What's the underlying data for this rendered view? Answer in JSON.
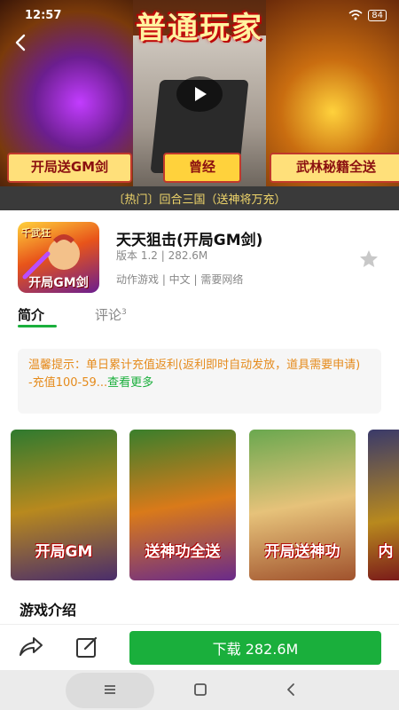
{
  "status_bar": {
    "time": "12:57",
    "battery": "84"
  },
  "banner": {
    "title_art": "普通玩家",
    "tag_left": "开局送GM剑",
    "tag_mid": "曾经",
    "tag_right": "武林秘籍全送"
  },
  "news_strip": "〔热门〕回合三国（送神将万充）",
  "app": {
    "icon_top": "千武狂",
    "icon_label": "开局GM剑",
    "title": "天天狙击(开局GM剑)",
    "meta": "版本 1.2 | 282.6M",
    "tags": "动作游戏 | 中文 | 需要网络"
  },
  "tabs": {
    "intro": "简介",
    "reviews": "评论",
    "reviews_count": "3"
  },
  "notice": {
    "text": "温馨提示：单日累计充值返利(返利即时自动发放，道具需要申请)",
    "line2": "-充值100-59...",
    "more": "查看更多"
  },
  "screenshots": [
    {
      "label": "开局GM"
    },
    {
      "label": "送神功全送"
    },
    {
      "label": "开局送神功"
    },
    {
      "label": "内"
    }
  ],
  "section_title": "游戏介绍",
  "bottom": {
    "download_label": "下载 282.6M"
  },
  "icons": {
    "back": "back-arrow-icon",
    "play": "play-icon",
    "star": "star-icon",
    "share": "share-icon",
    "comment": "comment-icon"
  },
  "colors": {
    "accent": "#1aaf3c",
    "notice": "#e58b1c",
    "news_bg": "#3a3a3a",
    "news_text": "#f0d66b"
  }
}
